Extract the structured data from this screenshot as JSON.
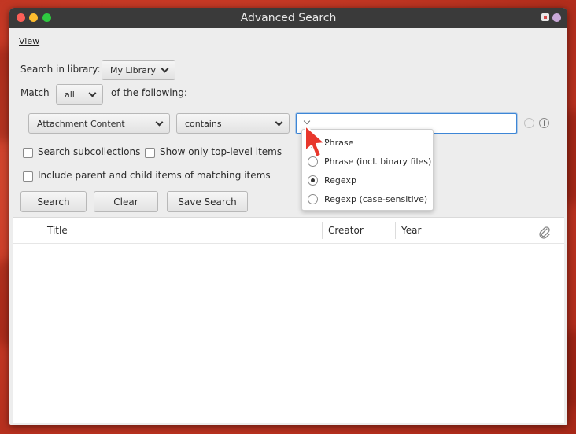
{
  "window": {
    "title": "Advanced Search"
  },
  "menu": {
    "view": "View"
  },
  "library": {
    "label": "Search in library:",
    "selected": "My Library"
  },
  "match": {
    "label": "Match",
    "selected": "all",
    "suffix": "of the following:"
  },
  "condition": {
    "field": "Attachment Content",
    "operator": "contains",
    "value": "",
    "mode_options": [
      {
        "label": "Phrase",
        "checked": false
      },
      {
        "label": "Phrase (incl. binary files)",
        "checked": false
      },
      {
        "label": "Regexp",
        "checked": true
      },
      {
        "label": "Regexp (case-sensitive)",
        "checked": false
      }
    ]
  },
  "options": {
    "search_subcollections": "Search subcollections",
    "top_level_only": "Show only top-level items",
    "include_parent_child": "Include parent and child items of matching items"
  },
  "buttons": {
    "search": "Search",
    "clear": "Clear",
    "save": "Save Search"
  },
  "results": {
    "columns": [
      "Title",
      "Creator",
      "Year"
    ]
  },
  "icons": {
    "minus": "−",
    "plus": "+",
    "attachment": "paperclip-icon"
  },
  "colors": {
    "focus": "#3d86d6",
    "titlebar": "#3a3a3a",
    "cursor": "#e8372c"
  }
}
